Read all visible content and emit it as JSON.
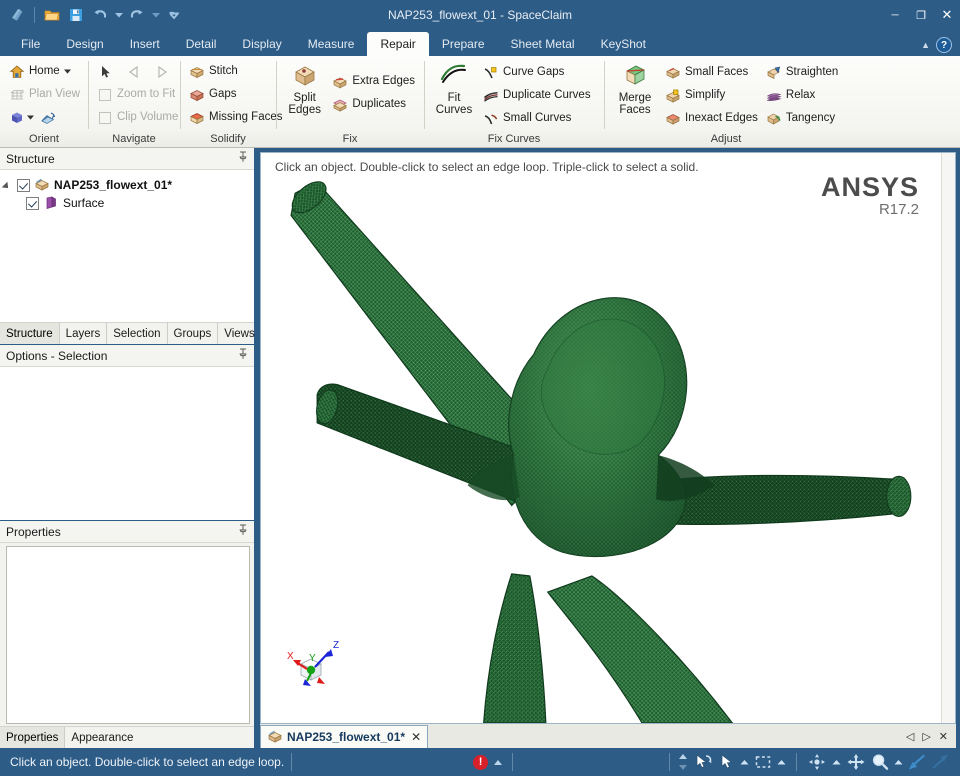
{
  "window": {
    "title": "NAP253_flowext_01 - SpaceClaim",
    "minimize_label": "─",
    "maximize_label": "❐",
    "close_label": "✕"
  },
  "quick_access": [
    {
      "name": "spaceclaim-logo-icon",
      "tip": "SpaceClaim"
    },
    {
      "name": "open-icon",
      "tip": "Open"
    },
    {
      "name": "save-icon",
      "tip": "Save"
    },
    {
      "name": "undo-icon",
      "tip": "Undo"
    },
    {
      "name": "undo-dropdown-icon",
      "tip": "Undo history"
    },
    {
      "name": "redo-icon",
      "tip": "Redo"
    },
    {
      "name": "redo-dropdown-icon",
      "tip": "Redo history"
    },
    {
      "name": "customize-qat-icon",
      "tip": "Customize Quick Access Toolbar"
    }
  ],
  "ribbon": {
    "tabs": [
      {
        "label": "File",
        "active": false
      },
      {
        "label": "Design",
        "active": false
      },
      {
        "label": "Insert",
        "active": false
      },
      {
        "label": "Detail",
        "active": false
      },
      {
        "label": "Display",
        "active": false
      },
      {
        "label": "Measure",
        "active": false
      },
      {
        "label": "Repair",
        "active": true
      },
      {
        "label": "Prepare",
        "active": false
      },
      {
        "label": "Sheet Metal",
        "active": false
      },
      {
        "label": "KeyShot",
        "active": false
      }
    ],
    "collapse_label": "▲",
    "help_label": "?",
    "groups": [
      {
        "label": "Orient",
        "items": [
          {
            "label": "Home",
            "icon": "home-icon",
            "dropdown": true,
            "disabled": false
          },
          {
            "label": "Plan View",
            "icon": "plan-view-icon",
            "dropdown": false,
            "disabled": true
          },
          {
            "label": "",
            "icon": "view-cube-icon",
            "dropdown": true,
            "disabled": false
          },
          {
            "label": "",
            "icon": "spin-icon",
            "dropdown": false,
            "disabled": false
          }
        ]
      },
      {
        "label": "Navigate",
        "items": [
          {
            "label": "",
            "icon": "cursor-icon",
            "disabled": false
          },
          {
            "label": "",
            "icon": "previous-view-icon",
            "disabled": true
          },
          {
            "label": "",
            "icon": "next-view-icon",
            "disabled": true
          },
          {
            "label": "Zoom to Fit",
            "icon": "checkbox-icon",
            "disabled": true
          },
          {
            "label": "Clip Volume",
            "icon": "checkbox-icon",
            "disabled": true
          }
        ]
      },
      {
        "label": "Solidify",
        "items": [
          {
            "label": "Stitch",
            "icon": "stitch-icon"
          },
          {
            "label": "Gaps",
            "icon": "gaps-icon"
          },
          {
            "label": "Missing Faces",
            "icon": "missing-faces-icon"
          }
        ]
      },
      {
        "label": "Fix",
        "big": {
          "label": "Split\nEdges",
          "line1": "Split",
          "line2": "Edges",
          "icon": "split-edges-icon"
        },
        "items": [
          {
            "label": "Extra Edges",
            "icon": "extra-edges-icon"
          },
          {
            "label": "Duplicates",
            "icon": "duplicates-icon"
          }
        ]
      },
      {
        "label": "Fix Curves",
        "big": {
          "line1": "Fit",
          "line2": "Curves",
          "icon": "fit-curves-icon"
        },
        "items": [
          {
            "label": "Curve Gaps",
            "icon": "curve-gaps-icon"
          },
          {
            "label": "Duplicate Curves",
            "icon": "duplicate-curves-icon"
          },
          {
            "label": "Small Curves",
            "icon": "small-curves-icon"
          }
        ]
      },
      {
        "label": "Adjust",
        "big": {
          "line1": "Merge",
          "line2": "Faces",
          "icon": "merge-faces-icon"
        },
        "items": [
          {
            "label": "Small Faces",
            "icon": "small-faces-icon"
          },
          {
            "label": "Simplify",
            "icon": "simplify-icon"
          },
          {
            "label": "Inexact Edges",
            "icon": "inexact-edges-icon"
          },
          {
            "label": "Straighten",
            "icon": "straighten-icon"
          },
          {
            "label": "Relax",
            "icon": "relax-icon"
          },
          {
            "label": "Tangency",
            "icon": "tangency-icon"
          }
        ]
      }
    ]
  },
  "structure_panel": {
    "title": "Structure",
    "pin_label": "📌",
    "tree": [
      {
        "label": "NAP253_flowext_01*",
        "icon": "component-icon",
        "checked": true,
        "bold": true,
        "level": 0,
        "expanded": true
      },
      {
        "label": "Surface",
        "icon": "surface-icon",
        "checked": true,
        "bold": false,
        "level": 1
      }
    ],
    "tabs": [
      {
        "label": "Structure",
        "active": true
      },
      {
        "label": "Layers",
        "active": false
      },
      {
        "label": "Selection",
        "active": false
      },
      {
        "label": "Groups",
        "active": false
      },
      {
        "label": "Views",
        "active": false
      }
    ]
  },
  "options_panel": {
    "title": "Options - Selection",
    "pin_label": "📌"
  },
  "properties_panel": {
    "title": "Properties",
    "pin_label": "📌",
    "tabs": [
      {
        "label": "Properties",
        "active": true
      },
      {
        "label": "Appearance",
        "active": false
      }
    ]
  },
  "viewport": {
    "hint": "Click an object. Double-click to select an edge loop. Triple-click to select a solid.",
    "brand_name": "ANSYS",
    "brand_version": "R17.2",
    "mesh_color": "#1d5c2e",
    "mesh_highlight": "#3f8a4e",
    "background": "#ffffff",
    "triad": {
      "x_label": "X",
      "y_label": "Y",
      "z_label": "Z",
      "x_color": "#e01b1b",
      "y_color": "#14a014",
      "z_color": "#1c26d8"
    }
  },
  "doc_tabs": {
    "tabs": [
      {
        "label": "NAP253_flowext_01*",
        "icon": "document-icon",
        "close_label": "✕",
        "active": true
      }
    ],
    "nav_prev": "◁",
    "nav_next": "▷",
    "nav_close": "✕"
  },
  "status_bar": {
    "message": "Click an object. Double-click to select an edge loop. Triple-cli",
    "error_icon": "error-icon",
    "error_label": "!",
    "tools": [
      {
        "name": "spin-stepper-icon",
        "label": "spin"
      },
      {
        "name": "undo-select-icon",
        "label": "undo selection"
      },
      {
        "name": "select-arrow-icon",
        "label": "select"
      },
      {
        "name": "select-dropdown-icon",
        "label": "select options"
      },
      {
        "name": "box-select-icon",
        "label": "box select"
      },
      {
        "name": "box-select-dropdown-icon",
        "label": "box select options"
      },
      {
        "name": "orbit-icon",
        "label": "orbit"
      },
      {
        "name": "orbit-dropdown-icon",
        "label": "orbit options"
      },
      {
        "name": "pan-icon",
        "label": "pan"
      },
      {
        "name": "zoom-icon",
        "label": "zoom"
      },
      {
        "name": "zoom-dropdown-icon",
        "label": "zoom options"
      },
      {
        "name": "zoom-in-icon",
        "label": "zoom in"
      },
      {
        "name": "zoom-out-icon",
        "label": "zoom out"
      }
    ]
  }
}
